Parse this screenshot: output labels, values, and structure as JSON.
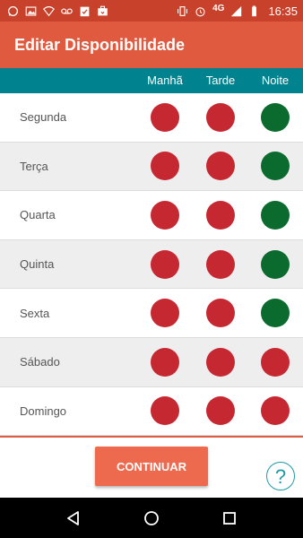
{
  "status_bar": {
    "left_icons": [
      "whatsapp-icon",
      "image-icon",
      "wifi-icon",
      "voicemail-icon",
      "clipboard-check-icon",
      "briefcase-icon"
    ],
    "right_icons": [
      "vibrate-icon",
      "alarm-icon",
      "signal-icon",
      "battery-icon"
    ],
    "network": "4G",
    "time": "16:35"
  },
  "app_bar": {
    "title": "Editar Disponibilidade"
  },
  "columns": [
    "Manhã",
    "Tarde",
    "Noite"
  ],
  "colors": {
    "unavailable": "#c62832",
    "available": "#0b6b2e",
    "status_bar": "#c8412a",
    "app_bar": "#e05a3f",
    "header": "#00838f",
    "button": "#ee6a4f",
    "help": "#1e9aa6"
  },
  "days": [
    {
      "label": "Segunda",
      "slots": [
        "unavailable",
        "unavailable",
        "available"
      ]
    },
    {
      "label": "Terça",
      "slots": [
        "unavailable",
        "unavailable",
        "available"
      ]
    },
    {
      "label": "Quarta",
      "slots": [
        "unavailable",
        "unavailable",
        "available"
      ]
    },
    {
      "label": "Quinta",
      "slots": [
        "unavailable",
        "unavailable",
        "available"
      ]
    },
    {
      "label": "Sexta",
      "slots": [
        "unavailable",
        "unavailable",
        "available"
      ]
    },
    {
      "label": "Sábado",
      "slots": [
        "unavailable",
        "unavailable",
        "unavailable"
      ]
    },
    {
      "label": "Domingo",
      "slots": [
        "unavailable",
        "unavailable",
        "unavailable"
      ]
    }
  ],
  "continue_button": {
    "label": "CONTINUAR"
  },
  "help_button": {
    "label": "?"
  },
  "nav_bar": {
    "icons": [
      "back-icon",
      "home-icon",
      "recents-icon"
    ]
  }
}
